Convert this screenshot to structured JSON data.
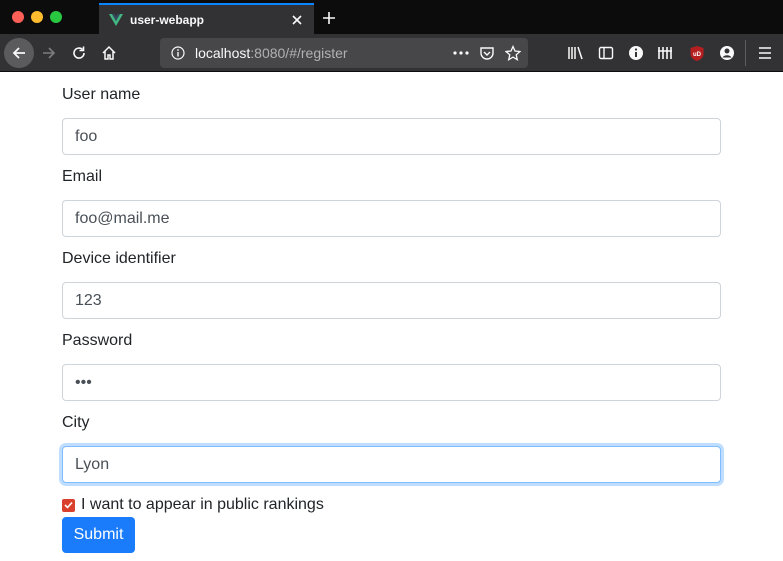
{
  "browser": {
    "tab_title": "user-webapp",
    "url_host": "localhost",
    "url_rest": ":8080/#/register",
    "accent_color": "#0a84ff",
    "toolbar_icons": [
      "library-icon",
      "sidebar-icon",
      "info-icon",
      "extension-icon",
      "ublock-icon",
      "account-icon",
      "menu-icon"
    ]
  },
  "form": {
    "fields": [
      {
        "label": "User name",
        "value": "foo"
      },
      {
        "label": "Email",
        "value": "foo@mail.me"
      },
      {
        "label": "Device identifier",
        "value": "123"
      },
      {
        "label": "Password",
        "value": "•••"
      },
      {
        "label": "City",
        "value": "Lyon"
      }
    ],
    "checkbox_label": "I want to appear in public rankings",
    "checkbox_checked": true,
    "submit_label": "Submit",
    "submit_color": "#1a7cfb",
    "checkbox_color": "#d9412e"
  }
}
